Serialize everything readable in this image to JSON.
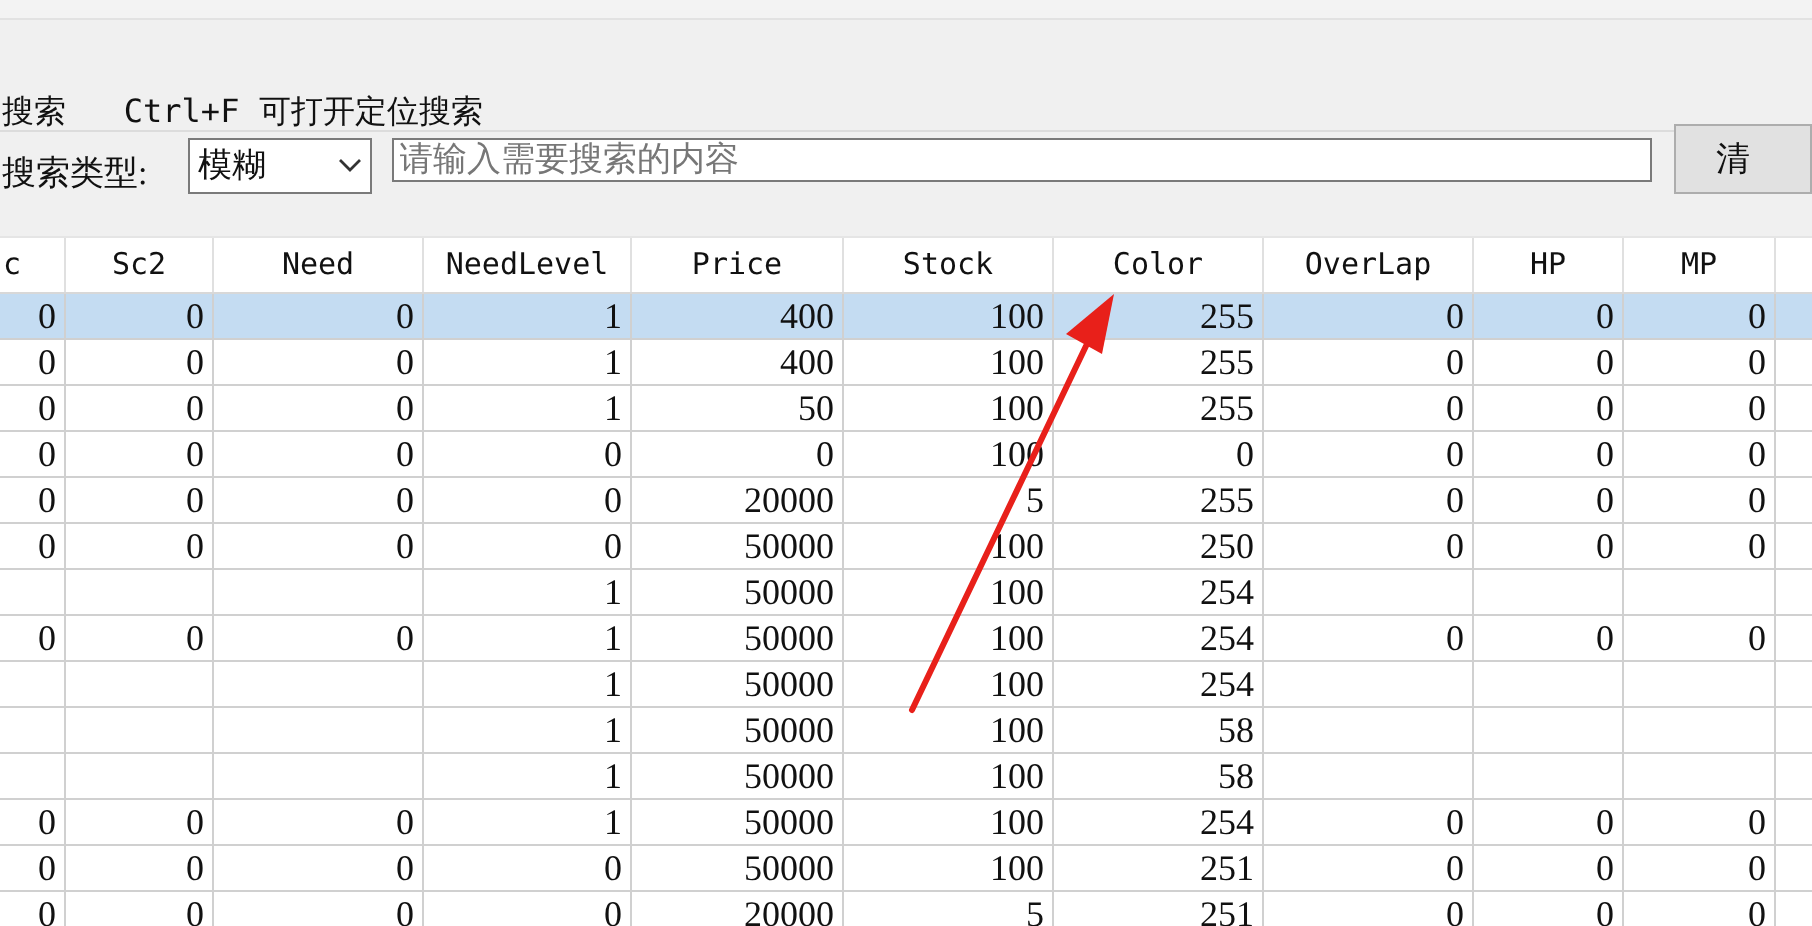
{
  "hint": "搜索   Ctrl+F 可打开定位搜索",
  "search": {
    "label": "搜索类型:",
    "type": "模糊",
    "placeholder": "请输入需要搜索的内容",
    "button": "清"
  },
  "table": {
    "columns": [
      "c",
      "Sc2",
      "Need",
      "NeedLevel",
      "Price",
      "Stock",
      "Color",
      "OverLap",
      "HP",
      "MP"
    ],
    "rows": [
      {
        "selected": true,
        "cells": [
          "0",
          "0",
          "0",
          "1",
          "400",
          "100",
          "255",
          "0",
          "0",
          "0"
        ]
      },
      {
        "selected": false,
        "cells": [
          "0",
          "0",
          "0",
          "1",
          "400",
          "100",
          "255",
          "0",
          "0",
          "0"
        ]
      },
      {
        "selected": false,
        "cells": [
          "0",
          "0",
          "0",
          "1",
          "50",
          "100",
          "255",
          "0",
          "0",
          "0"
        ]
      },
      {
        "selected": false,
        "cells": [
          "0",
          "0",
          "0",
          "0",
          "0",
          "100",
          "0",
          "0",
          "0",
          "0"
        ]
      },
      {
        "selected": false,
        "cells": [
          "0",
          "0",
          "0",
          "0",
          "20000",
          "5",
          "255",
          "0",
          "0",
          "0"
        ]
      },
      {
        "selected": false,
        "cells": [
          "0",
          "0",
          "0",
          "0",
          "50000",
          "100",
          "250",
          "0",
          "0",
          "0"
        ]
      },
      {
        "selected": false,
        "cells": [
          null,
          null,
          null,
          "1",
          "50000",
          "100",
          "254",
          null,
          null,
          null
        ]
      },
      {
        "selected": false,
        "cells": [
          "0",
          "0",
          "0",
          "1",
          "50000",
          "100",
          "254",
          "0",
          "0",
          "0"
        ]
      },
      {
        "selected": false,
        "cells": [
          null,
          null,
          null,
          "1",
          "50000",
          "100",
          "254",
          null,
          null,
          null
        ]
      },
      {
        "selected": false,
        "cells": [
          null,
          null,
          null,
          "1",
          "50000",
          "100",
          "58",
          null,
          null,
          null
        ]
      },
      {
        "selected": false,
        "cells": [
          null,
          null,
          null,
          "1",
          "50000",
          "100",
          "58",
          null,
          null,
          null
        ]
      },
      {
        "selected": false,
        "cells": [
          "0",
          "0",
          "0",
          "1",
          "50000",
          "100",
          "254",
          "0",
          "0",
          "0"
        ]
      },
      {
        "selected": false,
        "cells": [
          "0",
          "0",
          "0",
          "0",
          "50000",
          "100",
          "251",
          "0",
          "0",
          "0"
        ]
      },
      {
        "selected": false,
        "cells": [
          "0",
          "0",
          "0",
          "0",
          "20000",
          "5",
          "251",
          "0",
          "0",
          "0"
        ]
      }
    ]
  }
}
